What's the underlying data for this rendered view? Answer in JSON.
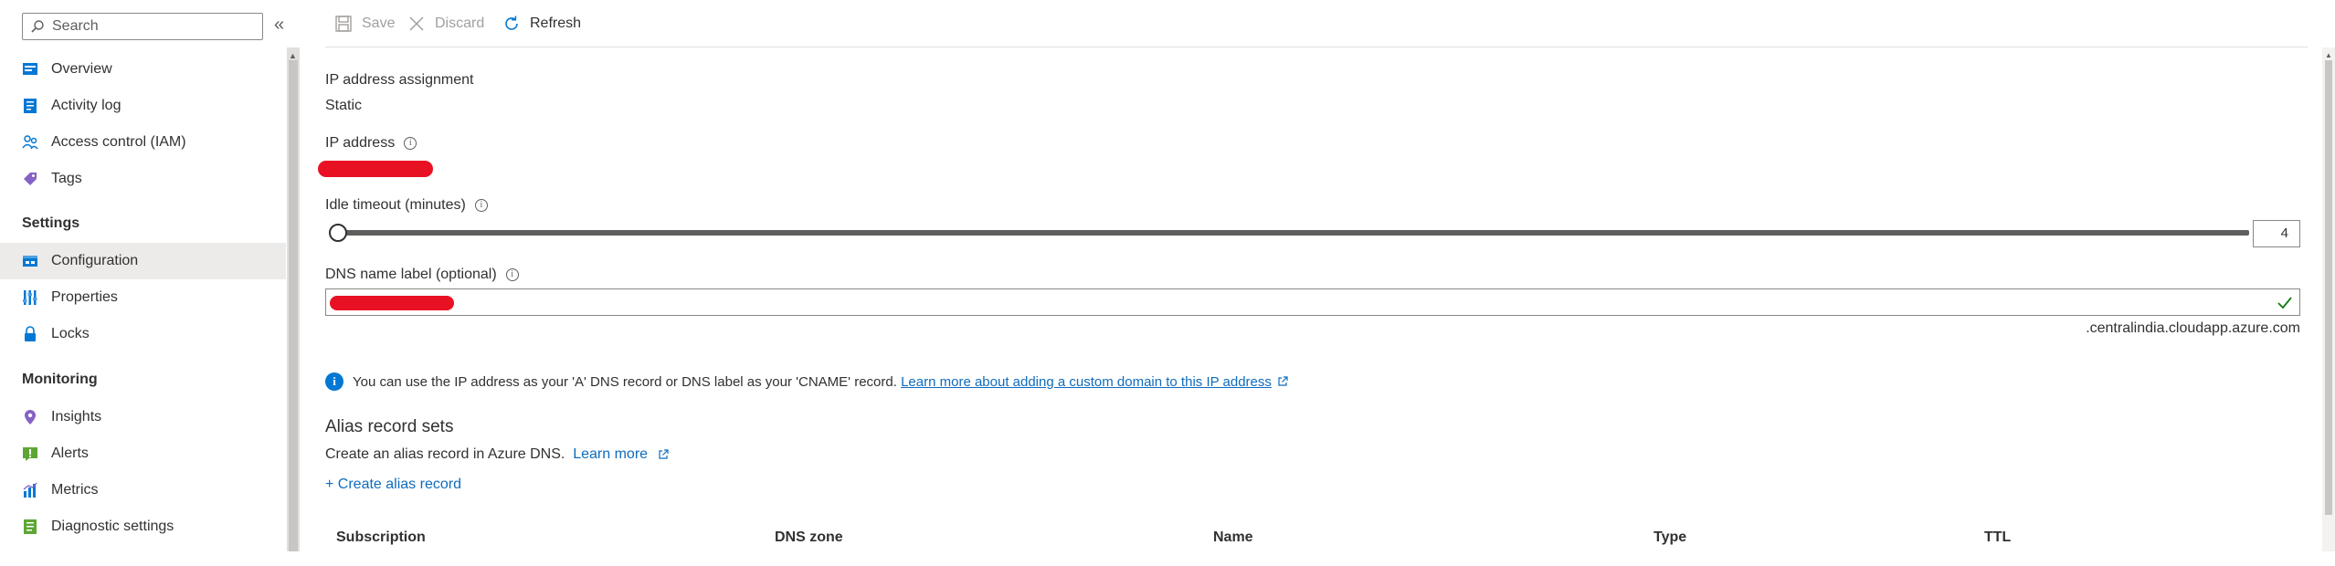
{
  "search": {
    "placeholder": "Search"
  },
  "sidebar": {
    "items": [
      {
        "label": "Overview",
        "icon": "overview-icon"
      },
      {
        "label": "Activity log",
        "icon": "activity-log-icon"
      },
      {
        "label": "Access control (IAM)",
        "icon": "iam-icon"
      },
      {
        "label": "Tags",
        "icon": "tag-icon"
      }
    ],
    "settings_header": "Settings",
    "settings": [
      {
        "label": "Configuration",
        "icon": "configuration-icon",
        "selected": true
      },
      {
        "label": "Properties",
        "icon": "properties-icon"
      },
      {
        "label": "Locks",
        "icon": "lock-icon"
      }
    ],
    "monitoring_header": "Monitoring",
    "monitoring": [
      {
        "label": "Insights",
        "icon": "insights-icon"
      },
      {
        "label": "Alerts",
        "icon": "alerts-icon"
      },
      {
        "label": "Metrics",
        "icon": "metrics-icon"
      },
      {
        "label": "Diagnostic settings",
        "icon": "diagnostic-settings-icon"
      }
    ]
  },
  "toolbar": {
    "save_label": "Save",
    "discard_label": "Discard",
    "refresh_label": "Refresh"
  },
  "form": {
    "ip_assignment_label": "IP address assignment",
    "ip_assignment_value": "Static",
    "ip_address_label": "IP address",
    "idle_timeout_label": "Idle timeout (minutes)",
    "idle_timeout_value": "4",
    "dns_label": "DNS name label (optional)",
    "dns_suffix": ".centralindia.cloudapp.azure.com"
  },
  "info": {
    "text": "You can use the IP address as your 'A' DNS record or DNS label as your 'CNAME' record.",
    "link": "Learn more about adding a custom domain to this IP address"
  },
  "alias": {
    "title": "Alias record sets",
    "description": "Create an alias record in Azure DNS.",
    "learn_more": "Learn more",
    "create_link": "+ Create alias record"
  },
  "table": {
    "columns": [
      "Subscription",
      "DNS zone",
      "Name",
      "Type",
      "TTL"
    ]
  },
  "colors": {
    "accent": "#0078d4",
    "link": "#0f6cbd",
    "redaction": "#e81123",
    "selected_bg": "#edebe9"
  }
}
